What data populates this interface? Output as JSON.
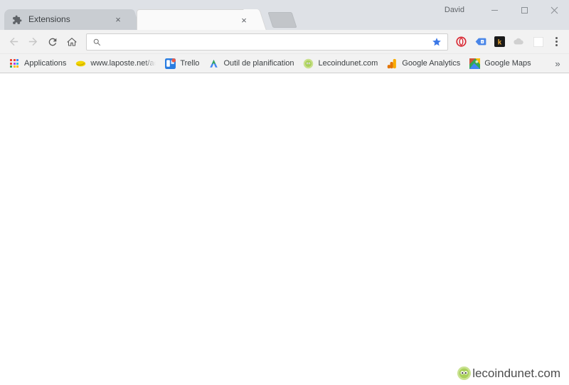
{
  "window": {
    "profile_name": "David",
    "controls": {
      "minimize_label": "Minimize",
      "maximize_label": "Maximize",
      "close_label": "Close"
    }
  },
  "tabs": [
    {
      "title": "Extensions",
      "favicon": "puzzle-piece-icon",
      "active": true,
      "close_label": "×"
    },
    {
      "title": "",
      "favicon": "none",
      "active": false,
      "close_label": "×"
    }
  ],
  "new_tab": {
    "label": "New tab"
  },
  "toolbar": {
    "back_label": "Back",
    "forward_label": "Forward",
    "reload_label": "Reload",
    "home_label": "Home",
    "omnibox": {
      "value": "",
      "placeholder": "",
      "search_icon": "search-icon"
    },
    "bookmark_star": {
      "label": "Bookmark this page",
      "color": "#3b78e7"
    },
    "extensions": [
      {
        "name": "opera-extension-icon",
        "label": "Opera",
        "color": "#d9232e"
      },
      {
        "name": "blue-tag-extension-icon",
        "label": "Tag",
        "color": "#4a86e8"
      },
      {
        "name": "k-extension-icon",
        "label": "K",
        "color": "#1a1a1a"
      },
      {
        "name": "grey-cloud-extension-icon",
        "label": "Cloud",
        "color": "#cccccc"
      },
      {
        "name": "white-square-extension-icon",
        "label": "Blank",
        "color": "#ffffff"
      }
    ],
    "menu_label": "Customize and control Google Chrome"
  },
  "bookmarks": {
    "items": [
      {
        "label": "Applications",
        "icon": "apps-grid-icon",
        "truncated": false
      },
      {
        "label": "www.laposte.net/acc",
        "icon": "laposte-icon",
        "truncated": true
      },
      {
        "label": "Trello",
        "icon": "trello-icon",
        "truncated": false
      },
      {
        "label": "Outil de planification",
        "icon": "google-ads-icon",
        "truncated": false
      },
      {
        "label": "Lecoindunet.com",
        "icon": "lecoindunet-icon",
        "truncated": false
      },
      {
        "label": "Google Analytics",
        "icon": "google-analytics-icon",
        "truncated": false
      },
      {
        "label": "Google Maps",
        "icon": "google-maps-icon",
        "truncated": false
      }
    ],
    "overflow_label": "»"
  },
  "page": {
    "body_text": "",
    "watermark": {
      "text": "lecoindunet.com",
      "logo": "lecoindunet-face-icon",
      "logo_color": "#a9d05a"
    }
  },
  "colors": {
    "tabstrip_bg": "#dee1e6",
    "toolbar_bg": "#f2f2f2",
    "active_tab_bg": "#c9cdd2",
    "page_bg": "#ffffff",
    "star_blue": "#3b78e7"
  }
}
